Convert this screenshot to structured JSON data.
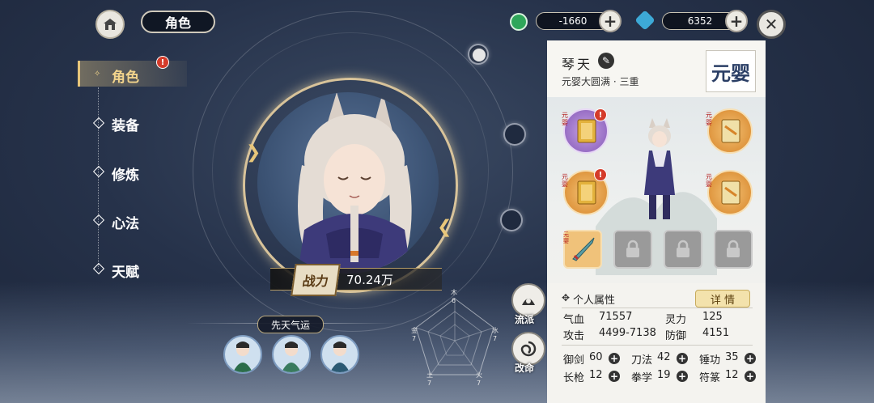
{
  "header": {
    "title": "角色",
    "currency1_value": "-1660",
    "currency2_value": "6352"
  },
  "nav": {
    "items": [
      {
        "label": "角色",
        "active": true,
        "badge": "!"
      },
      {
        "label": "装备"
      },
      {
        "label": "修炼"
      },
      {
        "label": "心法"
      },
      {
        "label": "天赋"
      }
    ]
  },
  "portrait": {
    "power_label": "战力",
    "power_value": "70.24万"
  },
  "luck": {
    "title": "先天气运"
  },
  "radar": {
    "labels": {
      "wood": "木",
      "water": "水",
      "fire": "火",
      "earth": "土",
      "metal": "金"
    },
    "values": {
      "wood": "6",
      "water": "7",
      "fire": "7",
      "earth": "7",
      "metal": "7"
    }
  },
  "side_buttons": {
    "sect_label": "流派",
    "fate_label": "改命"
  },
  "panel": {
    "name": "琴天",
    "realm": "元婴大圆满 · 三重",
    "seal_text": "元婴",
    "slot_tag": "元婴",
    "weapon_tag": "元婴",
    "attr_title": "个人属性",
    "detail_label": "详 情",
    "stats": [
      {
        "label": "气血",
        "value": "71557"
      },
      {
        "label": "灵力",
        "value": "125"
      },
      {
        "label": "攻击",
        "value": "4499-7138"
      },
      {
        "label": "防御",
        "value": "4151"
      }
    ],
    "skills": [
      {
        "label": "御剑",
        "value": "60"
      },
      {
        "label": "刀法",
        "value": "42"
      },
      {
        "label": "锤功",
        "value": "35"
      },
      {
        "label": "长枪",
        "value": "12"
      },
      {
        "label": "拳学",
        "value": "19"
      },
      {
        "label": "符篆",
        "value": "12"
      }
    ]
  },
  "colors": {
    "accent_gold": "#d8c39a",
    "badge_red": "#d43b2a",
    "panel_bg": "#f4f3ef"
  }
}
